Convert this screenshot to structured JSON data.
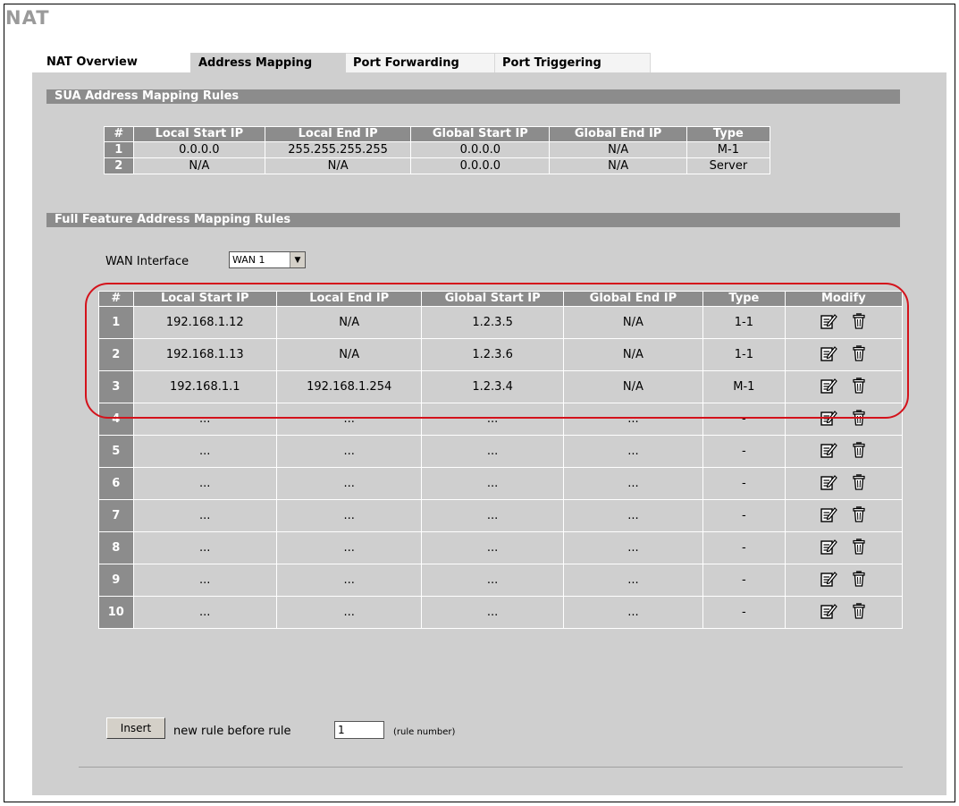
{
  "page": {
    "title": "NAT"
  },
  "tabs": [
    {
      "label": "NAT Overview",
      "active": false
    },
    {
      "label": "Address Mapping",
      "active": true
    },
    {
      "label": "Port Forwarding",
      "active": false
    },
    {
      "label": "Port Triggering",
      "active": false
    }
  ],
  "sua": {
    "title": "SUA Address Mapping Rules",
    "headers": [
      "#",
      "Local Start IP",
      "Local End IP",
      "Global Start IP",
      "Global End IP",
      "Type"
    ],
    "rows": [
      {
        "num": "1",
        "local_start": "0.0.0.0",
        "local_end": "255.255.255.255",
        "global_start": "0.0.0.0",
        "global_end": "N/A",
        "type": "M-1"
      },
      {
        "num": "2",
        "local_start": "N/A",
        "local_end": "N/A",
        "global_start": "0.0.0.0",
        "global_end": "N/A",
        "type": "Server"
      }
    ]
  },
  "full": {
    "title": "Full Feature Address Mapping Rules",
    "wan_label": "WAN Interface",
    "wan_value": "WAN 1",
    "headers": [
      "#",
      "Local Start IP",
      "Local End IP",
      "Global Start IP",
      "Global End IP",
      "Type",
      "Modify"
    ],
    "rows": [
      {
        "num": "1",
        "local_start": "192.168.1.12",
        "local_end": "N/A",
        "global_start": "1.2.3.5",
        "global_end": "N/A",
        "type": "1-1"
      },
      {
        "num": "2",
        "local_start": "192.168.1.13",
        "local_end": "N/A",
        "global_start": "1.2.3.6",
        "global_end": "N/A",
        "type": "1-1"
      },
      {
        "num": "3",
        "local_start": "192.168.1.1",
        "local_end": "192.168.1.254",
        "global_start": "1.2.3.4",
        "global_end": "N/A",
        "type": "M-1"
      },
      {
        "num": "4",
        "local_start": "...",
        "local_end": "...",
        "global_start": "...",
        "global_end": "...",
        "type": "-"
      },
      {
        "num": "5",
        "local_start": "...",
        "local_end": "...",
        "global_start": "...",
        "global_end": "...",
        "type": "-"
      },
      {
        "num": "6",
        "local_start": "...",
        "local_end": "...",
        "global_start": "...",
        "global_end": "...",
        "type": "-"
      },
      {
        "num": "7",
        "local_start": "...",
        "local_end": "...",
        "global_start": "...",
        "global_end": "...",
        "type": "-"
      },
      {
        "num": "8",
        "local_start": "...",
        "local_end": "...",
        "global_start": "...",
        "global_end": "...",
        "type": "-"
      },
      {
        "num": "9",
        "local_start": "...",
        "local_end": "...",
        "global_start": "...",
        "global_end": "...",
        "type": "-"
      },
      {
        "num": "10",
        "local_start": "...",
        "local_end": "...",
        "global_start": "...",
        "global_end": "...",
        "type": "-"
      }
    ]
  },
  "insert": {
    "button_label": "Insert",
    "text": "new rule before rule",
    "rule_value": "1",
    "hint": "(rule number)"
  },
  "icons": {
    "edit": "edit-icon",
    "delete": "trash-icon"
  },
  "colors": {
    "header_bg": "#8c8c8c",
    "panel_bg": "#cfcfcf",
    "highlight": "#d4121b",
    "title": "#9a9a9a"
  }
}
